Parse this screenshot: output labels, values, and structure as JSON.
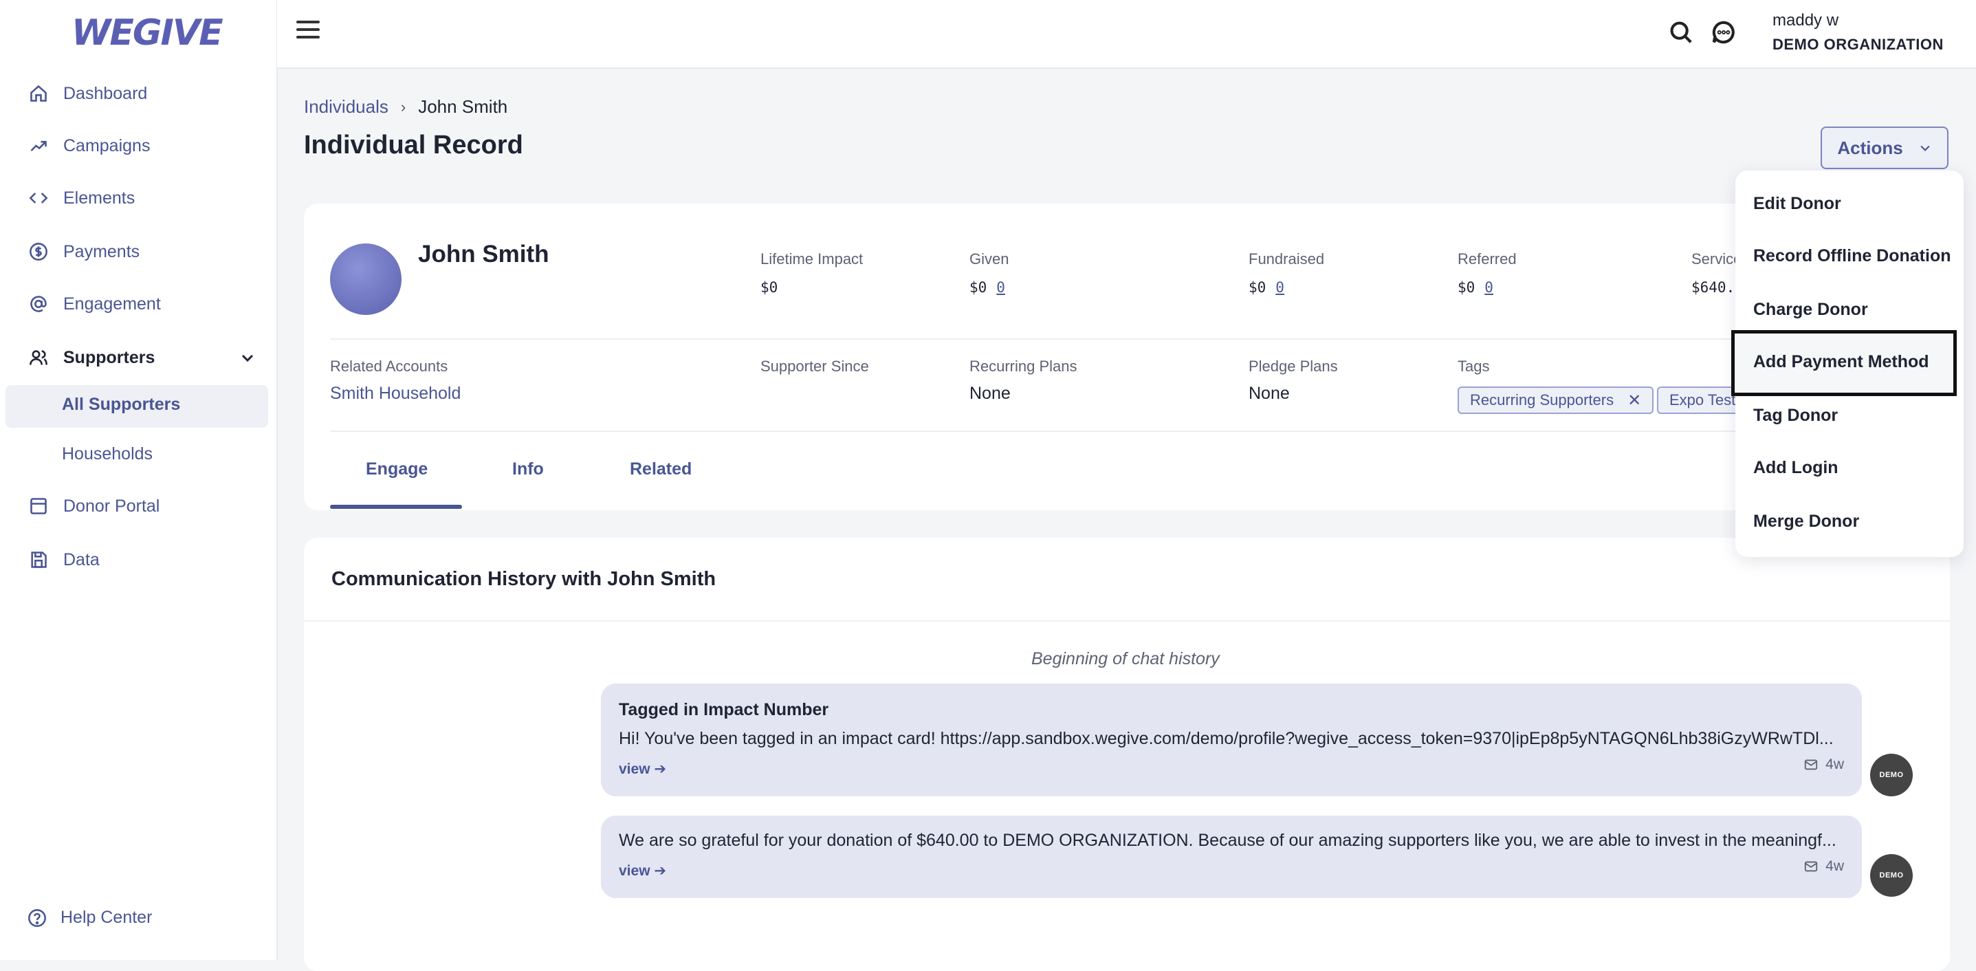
{
  "brand": {
    "logo_text": "WEGIVE",
    "accent": "#4a5593"
  },
  "sidebar": {
    "items": [
      {
        "label": "Dashboard",
        "icon": "home-icon"
      },
      {
        "label": "Campaigns",
        "icon": "trend-icon"
      },
      {
        "label": "Elements",
        "icon": "code-icon"
      },
      {
        "label": "Payments",
        "icon": "dollar-icon"
      },
      {
        "label": "Engagement",
        "icon": "at-icon"
      },
      {
        "label": "Supporters",
        "icon": "users-icon"
      },
      {
        "label": "Donor Portal",
        "icon": "portal-icon"
      },
      {
        "label": "Data",
        "icon": "save-icon"
      }
    ],
    "sub_items": [
      {
        "label": "All Supporters"
      },
      {
        "label": "Households"
      }
    ],
    "help": "Help Center"
  },
  "topbar": {
    "user_name": "maddy w",
    "org_name": "DEMO ORGANIZATION"
  },
  "breadcrumb": {
    "parent": "Individuals",
    "separator": "›",
    "current": "John Smith"
  },
  "page_title": "Individual Record",
  "actions_label": "Actions",
  "profile": {
    "name": "John Smith",
    "stats": [
      {
        "label": "Lifetime Impact",
        "value": "$0",
        "link": ""
      },
      {
        "label": "Given",
        "value": "$0",
        "link": "0"
      },
      {
        "label": "Fundraised",
        "value": "$0",
        "link": "0"
      },
      {
        "label": "Referred",
        "value": "$0",
        "link": "0"
      },
      {
        "label": "Service",
        "value": "$640.",
        "link": ""
      }
    ],
    "fields": {
      "related_accounts_label": "Related Accounts",
      "related_accounts_value": "Smith Household",
      "supporter_since_label": "Supporter Since",
      "recurring_label": "Recurring Plans",
      "recurring_value": "None",
      "pledge_label": "Pledge Plans",
      "pledge_value": "None",
      "tags_label": "Tags"
    },
    "tags": [
      "Recurring Supporters",
      "Expo Test"
    ],
    "tabs": [
      "Engage",
      "Info",
      "Related"
    ]
  },
  "communication": {
    "title": "Communication History with John Smith",
    "beginning": "Beginning of chat history",
    "messages": [
      {
        "title": "Tagged in Impact Number",
        "text": "Hi! You've been tagged in an impact card! https://app.sandbox.wegive.com/demo/profile?wegive_access_token=9370|ipEp8p5yNTAGQN6Lhb38iGzyWRwTDl...",
        "view": "view ➔",
        "age": "4w",
        "sender": "DEMO"
      },
      {
        "title": "",
        "text": "We are so grateful for your donation of $640.00 to DEMO ORGANIZATION. Because of our amazing supporters like you, we are able to invest in the meaningf...",
        "view": "view ➔",
        "age": "4w",
        "sender": "DEMO"
      }
    ]
  },
  "actions_menu": {
    "items": [
      "Edit Donor",
      "Record Offline Donation",
      "Charge Donor",
      "Add Payment Method",
      "Tag Donor",
      "Add Login",
      "Merge Donor"
    ],
    "focused": "Add Payment Method"
  }
}
